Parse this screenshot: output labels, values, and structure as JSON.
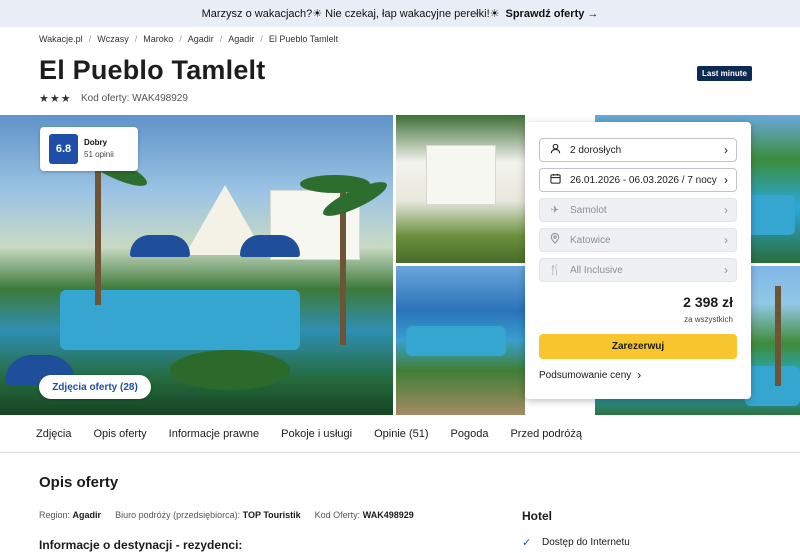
{
  "promo": {
    "text": "Marzysz o wakacjach?☀ Nie czekaj, łap wakacyjne perełki!☀",
    "cta": "Sprawdź oferty →"
  },
  "breadcrumbs": [
    "Wakacje.pl",
    "Wczasy",
    "Maroko",
    "Agadir",
    "Agadir",
    "El Pueblo Tamlelt"
  ],
  "hotel": {
    "name": "El Pueblo Tamlelt",
    "badge": "Last minute",
    "stars": 3,
    "offer_code_label": "Kod oferty:",
    "offer_code": "WAK498929"
  },
  "rating": {
    "score": "6.8",
    "label": "Dobry",
    "count": "51 opinii"
  },
  "gallery": {
    "photos_button": "Zdjęcia oferty (28)"
  },
  "booking": {
    "travelers": "2 dorosłych",
    "dates": "26.01.2026 - 06.03.2026 / 7 nocy",
    "transport": "Samolot",
    "departure": "Katowice",
    "board": "All Inclusive",
    "price": "2 398 zł",
    "price_note": "za wszystkich",
    "book_label": "Zarezerwuj",
    "summary_label": "Podsumowanie ceny"
  },
  "tabs": [
    "Zdjęcia",
    "Opis oferty",
    "Informacje prawne",
    "Pokoje i usługi",
    "Opinie (51)",
    "Pogoda",
    "Przed podróżą"
  ],
  "description": {
    "title": "Opis oferty",
    "region_label": "Region:",
    "region": "Agadir",
    "agency_label": "Biuro podróży (przedsiębiorca):",
    "agency": "TOP Touristik",
    "code_label": "Kod Oferty:",
    "code": "WAK498929",
    "dest_title": "Informacje o destynacji - rezydenci:"
  },
  "hotel_panel": {
    "title": "Hotel",
    "feature_1": "Dostęp do Internetu"
  },
  "icons": {
    "star": "star-icon",
    "chevron": "chevron-right-icon",
    "check": "check-icon"
  }
}
